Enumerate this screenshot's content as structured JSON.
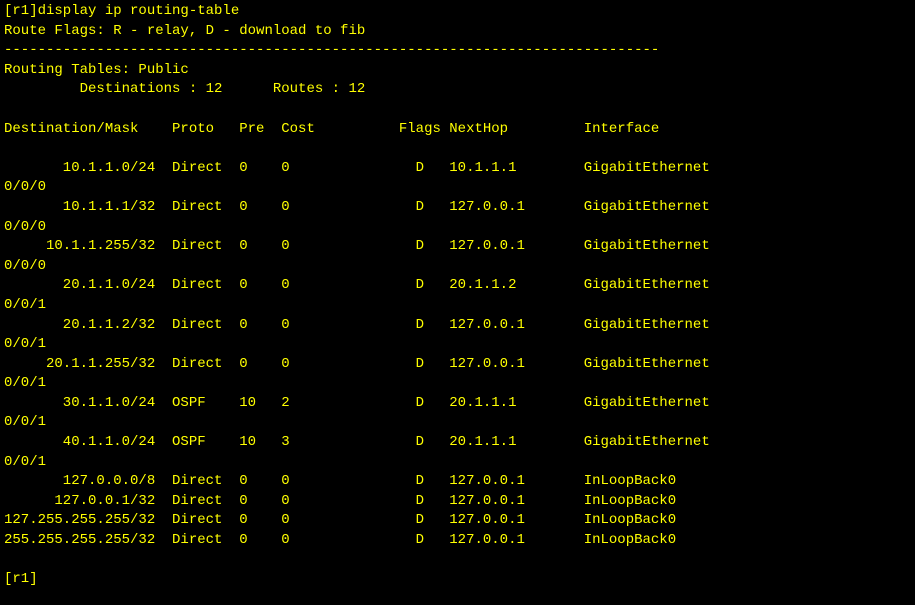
{
  "prompt_open": "[r1]",
  "command": "display ip routing-table",
  "flags_line": "Route Flags: R - relay, D - download to fib",
  "divider": "------------------------------------------------------------------------------",
  "tables_header": "Routing Tables: Public",
  "destinations_label": "Destinations :",
  "destinations_count": "12",
  "routes_label": "Routes :",
  "routes_count": "12",
  "cols": {
    "dest": "Destination/Mask",
    "proto": "Proto",
    "pre": "Pre",
    "cost": "Cost",
    "flags": "Flags",
    "nexthop": "NextHop",
    "interface": "Interface"
  },
  "routes": [
    {
      "dest": "10.1.1.0/24",
      "proto": "Direct",
      "pre": "0",
      "cost": "0",
      "flags": "D",
      "nexthop": "10.1.1.1",
      "iface": "GigabitEthernet",
      "iface2": "0/0/0"
    },
    {
      "dest": "10.1.1.1/32",
      "proto": "Direct",
      "pre": "0",
      "cost": "0",
      "flags": "D",
      "nexthop": "127.0.0.1",
      "iface": "GigabitEthernet",
      "iface2": "0/0/0"
    },
    {
      "dest": "10.1.1.255/32",
      "proto": "Direct",
      "pre": "0",
      "cost": "0",
      "flags": "D",
      "nexthop": "127.0.0.1",
      "iface": "GigabitEthernet",
      "iface2": "0/0/0"
    },
    {
      "dest": "20.1.1.0/24",
      "proto": "Direct",
      "pre": "0",
      "cost": "0",
      "flags": "D",
      "nexthop": "20.1.1.2",
      "iface": "GigabitEthernet",
      "iface2": "0/0/1"
    },
    {
      "dest": "20.1.1.2/32",
      "proto": "Direct",
      "pre": "0",
      "cost": "0",
      "flags": "D",
      "nexthop": "127.0.0.1",
      "iface": "GigabitEthernet",
      "iface2": "0/0/1"
    },
    {
      "dest": "20.1.1.255/32",
      "proto": "Direct",
      "pre": "0",
      "cost": "0",
      "flags": "D",
      "nexthop": "127.0.0.1",
      "iface": "GigabitEthernet",
      "iface2": "0/0/1"
    },
    {
      "dest": "30.1.1.0/24",
      "proto": "OSPF",
      "pre": "10",
      "cost": "2",
      "flags": "D",
      "nexthop": "20.1.1.1",
      "iface": "GigabitEthernet",
      "iface2": "0/0/1"
    },
    {
      "dest": "40.1.1.0/24",
      "proto": "OSPF",
      "pre": "10",
      "cost": "3",
      "flags": "D",
      "nexthop": "20.1.1.1",
      "iface": "GigabitEthernet",
      "iface2": "0/0/1"
    },
    {
      "dest": "127.0.0.0/8",
      "proto": "Direct",
      "pre": "0",
      "cost": "0",
      "flags": "D",
      "nexthop": "127.0.0.1",
      "iface": "InLoopBack0",
      "iface2": ""
    },
    {
      "dest": "127.0.0.1/32",
      "proto": "Direct",
      "pre": "0",
      "cost": "0",
      "flags": "D",
      "nexthop": "127.0.0.1",
      "iface": "InLoopBack0",
      "iface2": ""
    },
    {
      "dest": "127.255.255.255/32",
      "proto": "Direct",
      "pre": "0",
      "cost": "0",
      "flags": "D",
      "nexthop": "127.0.0.1",
      "iface": "InLoopBack0",
      "iface2": ""
    },
    {
      "dest": "255.255.255.255/32",
      "proto": "Direct",
      "pre": "0",
      "cost": "0",
      "flags": "D",
      "nexthop": "127.0.0.1",
      "iface": "InLoopBack0",
      "iface2": ""
    }
  ],
  "prompt_close": "[r1]"
}
